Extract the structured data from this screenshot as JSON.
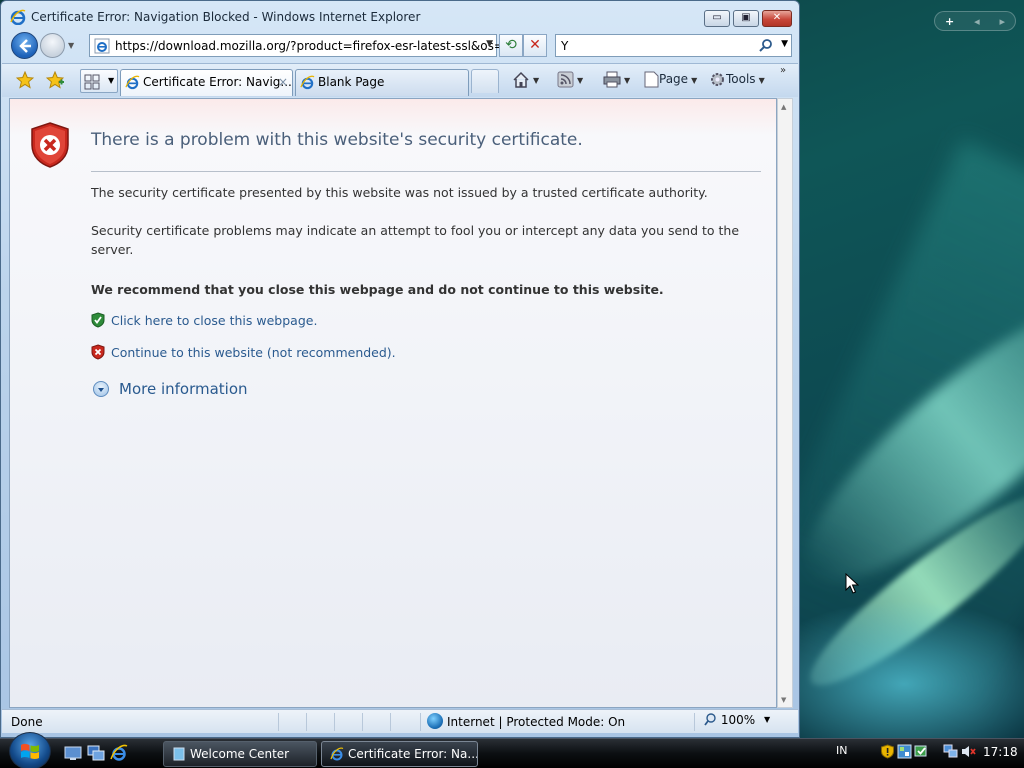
{
  "window": {
    "title": "Certificate Error: Navigation Blocked - Windows Internet Explorer",
    "controls": {
      "minimize": "▭",
      "maximize": "▣",
      "close": "✕"
    }
  },
  "address_bar": {
    "url": "https://download.mozilla.org/?product=firefox-esr-latest-ssl&os=wi"
  },
  "search_box": {
    "value": "Y"
  },
  "tabs": [
    {
      "label": "Certificate Error: Navig...",
      "active": true,
      "close": "×"
    },
    {
      "label": "Blank Page",
      "active": false
    }
  ],
  "command_bar": {
    "page_label": "Page",
    "tools_label": "Tools",
    "chevron": "»"
  },
  "page": {
    "headline": "There is a problem with this website's security certificate.",
    "para1": "The security certificate presented by this website was not issued by a trusted certificate authority.",
    "para2": "Security certificate problems may indicate an attempt to fool you or intercept any data you send to the server.",
    "recommend": "We recommend that you close this webpage and do not continue to this website.",
    "close_link": "Click here to close this webpage.",
    "continue_link": "Continue to this website (not recommended).",
    "more_info": "More information"
  },
  "status_bar": {
    "status": "Done",
    "zone": "Internet | Protected Mode: On",
    "zoom": "100%"
  },
  "taskbar": {
    "buttons": [
      {
        "label": "Welcome Center"
      },
      {
        "label": "Certificate Error: Na..."
      }
    ],
    "language": "IN",
    "clock": "17:18"
  },
  "colors": {
    "link": "#2a5a8f",
    "headline": "#4a5f7a",
    "danger": "#c8281e",
    "safe": "#2e8b3a"
  }
}
